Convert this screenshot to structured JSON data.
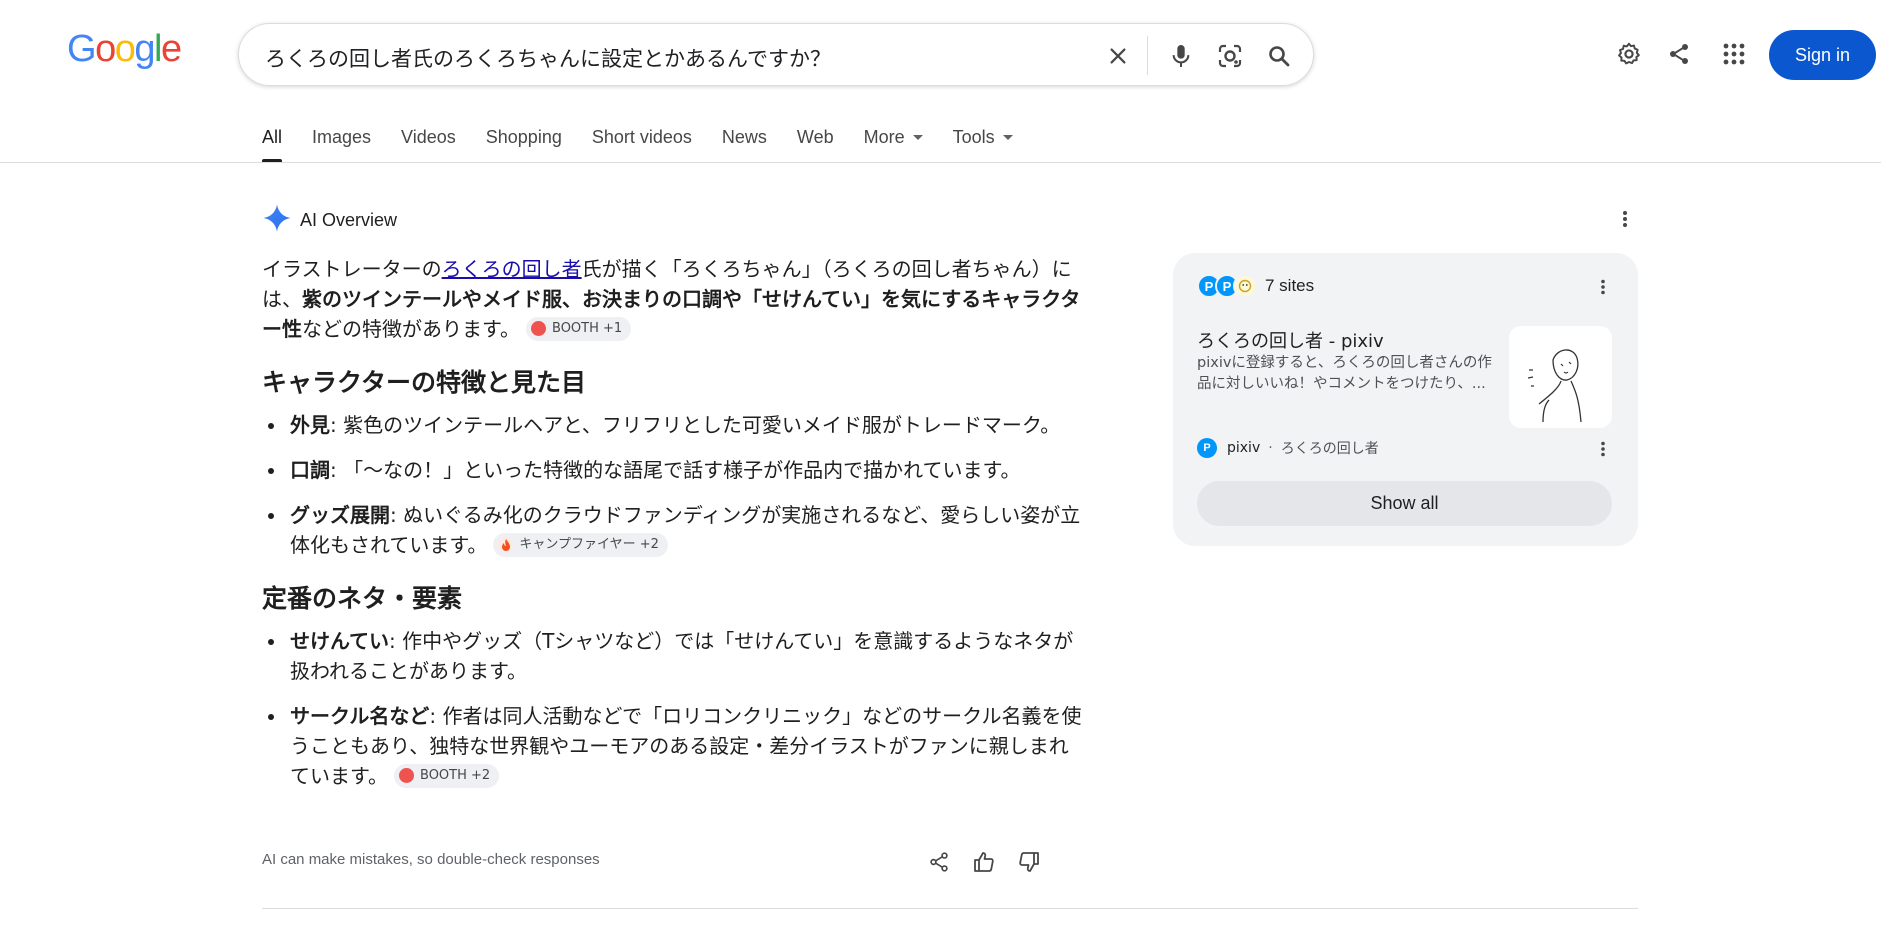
{
  "logo": {
    "text": "Google",
    "letters": [
      "G",
      "o",
      "o",
      "g",
      "l",
      "e"
    ]
  },
  "search": {
    "query": "ろくろの回し者氏のろくろちゃんに設定とかあるんですか？",
    "icons": [
      "close-icon",
      "mic-icon",
      "lens-icon",
      "search-icon"
    ]
  },
  "header": {
    "icons": [
      "settings-icon",
      "share-icon",
      "apps-icon"
    ],
    "sign_in_label": "Sign in",
    "colors": {
      "sign_in_bg": "#0b57d0"
    }
  },
  "tabs": [
    {
      "label": "All",
      "active": true
    },
    {
      "label": "Images"
    },
    {
      "label": "Videos"
    },
    {
      "label": "Shopping"
    },
    {
      "label": "Short videos"
    },
    {
      "label": "News"
    },
    {
      "label": "Web"
    },
    {
      "label": "More",
      "dropdown": true
    },
    {
      "label": "Tools",
      "dropdown": true
    }
  ],
  "ai_overview": {
    "title": "AI Overview",
    "intro": {
      "pre": "イラストレーターの",
      "link": "ろくろの回し者",
      "mid": "氏が描く「ろくろちゃん」（ろくろの回し者ちゃん）には、",
      "bold": "紫のツインテールやメイド服、お決まりの口調や「せけんてい」を気にするキャラクター性",
      "post": "などの特徴があります。",
      "chip": "BOOTH +1"
    },
    "section1": {
      "heading": "キャラクターの特徴と見た目",
      "items": [
        {
          "term": "外見",
          "text": ": 紫色のツインテールヘアと、フリフリとした可愛いメイド服がトレードマーク。",
          "chip": ""
        },
        {
          "term": "口調",
          "text": ": 「〜なの！」といった特徴的な語尾で話す様子が作品内で描かれています。",
          "chip": ""
        },
        {
          "term": "グッズ展開",
          "text": ": ぬいぐるみ化のクラウドファンディングが実施されるなど、愛らしい姿が立体化もされています。",
          "chip": "キャンプファイヤー +2"
        }
      ]
    },
    "section2": {
      "heading": "定番のネタ・要素",
      "items": [
        {
          "term": "せけんてい",
          "text": ": 作中やグッズ（Tシャツなど）では「せけんてい」を意識するようなネタが扱われることがあります。",
          "chip": ""
        },
        {
          "term": "サークル名など",
          "text": ": 作者は同人活動などで「ロリコンクリニック」などのサークル名義を使うこともあり、独特な世界観やユーモアのある設定・差分イラストがファンに親しまれています。",
          "chip": "BOOTH +2"
        }
      ]
    },
    "disclaimer": "AI can make mistakes, so double-check responses",
    "feedback_icons": [
      "share-icon",
      "thumbs-up-icon",
      "thumbs-down-icon"
    ]
  },
  "sites_panel": {
    "count_label": "7 sites",
    "favicons": [
      "pixiv",
      "pixiv",
      "booth"
    ],
    "card": {
      "title": "ろくろの回し者 - pixiv",
      "snippet": "pixivに登録すると、ろくろの回し者さんの作品に対しいいね！やコメントをつけたり、...",
      "source_name": "pixiv",
      "source_path": "ろくろの回し者"
    },
    "show_all_label": "Show all"
  }
}
